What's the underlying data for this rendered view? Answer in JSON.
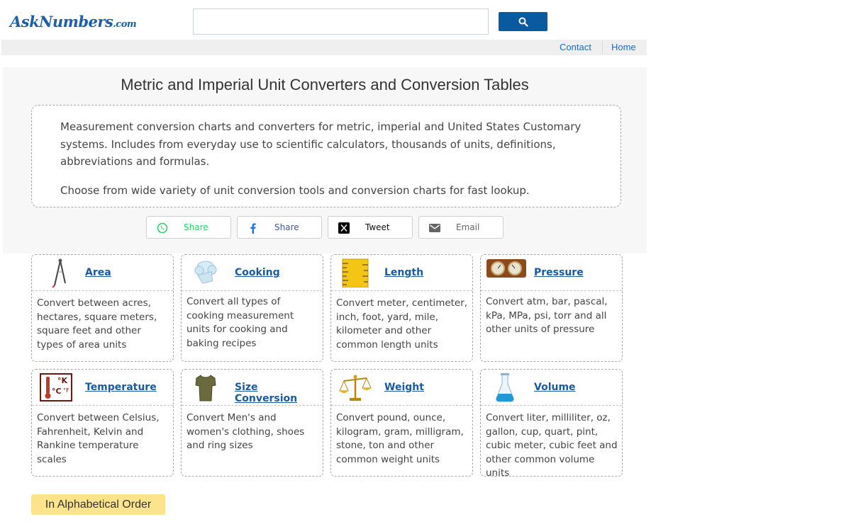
{
  "header": {
    "logo_main": "AskNumbers",
    "logo_tld": ".com",
    "search_placeholder": ""
  },
  "nav": {
    "contact": "Contact",
    "home": "Home"
  },
  "hero": {
    "title": "Metric and Imperial Unit Converters and Conversion Tables",
    "paragraph1": "Measurement conversion charts and converters for metric, imperial and United States Customary systems. Includes from everyday use to scientific calculators, thousands of units, definitions, abbreviations and formulas.",
    "paragraph2": "Choose from wide variety of unit conversion tools and conversion charts for fast lookup."
  },
  "share": {
    "whatsapp": "Share",
    "facebook": "Share",
    "x": "Tweet",
    "email": "Email"
  },
  "categories": [
    {
      "title": "Area",
      "icon": "compass-icon",
      "desc": "Convert between acres, hectares, square meters, square feet and other types of area units"
    },
    {
      "title": "Cooking",
      "icon": "chef-hat-icon",
      "desc": "Convert all types of cooking measurement units for cooking and baking recipes"
    },
    {
      "title": "Length",
      "icon": "ruler-icon",
      "desc": "Convert meter, centimeter, inch, foot, yard, mile, kilometer and other common length units"
    },
    {
      "title": "Pressure",
      "icon": "pressure-gauge-icon",
      "desc": "Convert atm, bar, pascal, kPa, MPa, psi, torr and all other units of pressure"
    },
    {
      "title": "Temperature",
      "icon": "thermometer-icon",
      "desc": "Convert between Celsius, Fahrenheit, Kelvin and Rankine temperature scales"
    },
    {
      "title": "Size Conversion",
      "icon": "tshirt-icon",
      "desc": "Convert Men's and women's clothing, shoes and ring sizes"
    },
    {
      "title": "Weight",
      "icon": "scale-icon",
      "desc": "Convert pound, ounce, kilogram, gram, milligram, stone, ton and other common weight units"
    },
    {
      "title": "Volume",
      "icon": "flask-icon",
      "desc": "Convert liter, milliliter, oz, gallon, cup, quart, pint, cubic meter, cubic feet and other common volume units"
    }
  ],
  "alphabetical_button": "In Alphabetical Order",
  "colors": {
    "brand_blue": "#0a5aa0",
    "link_blue": "#1a5aa0",
    "whatsapp_green": "#25d366",
    "facebook_blue": "#1877f2",
    "alpha_button_bg": "#fde38c"
  }
}
